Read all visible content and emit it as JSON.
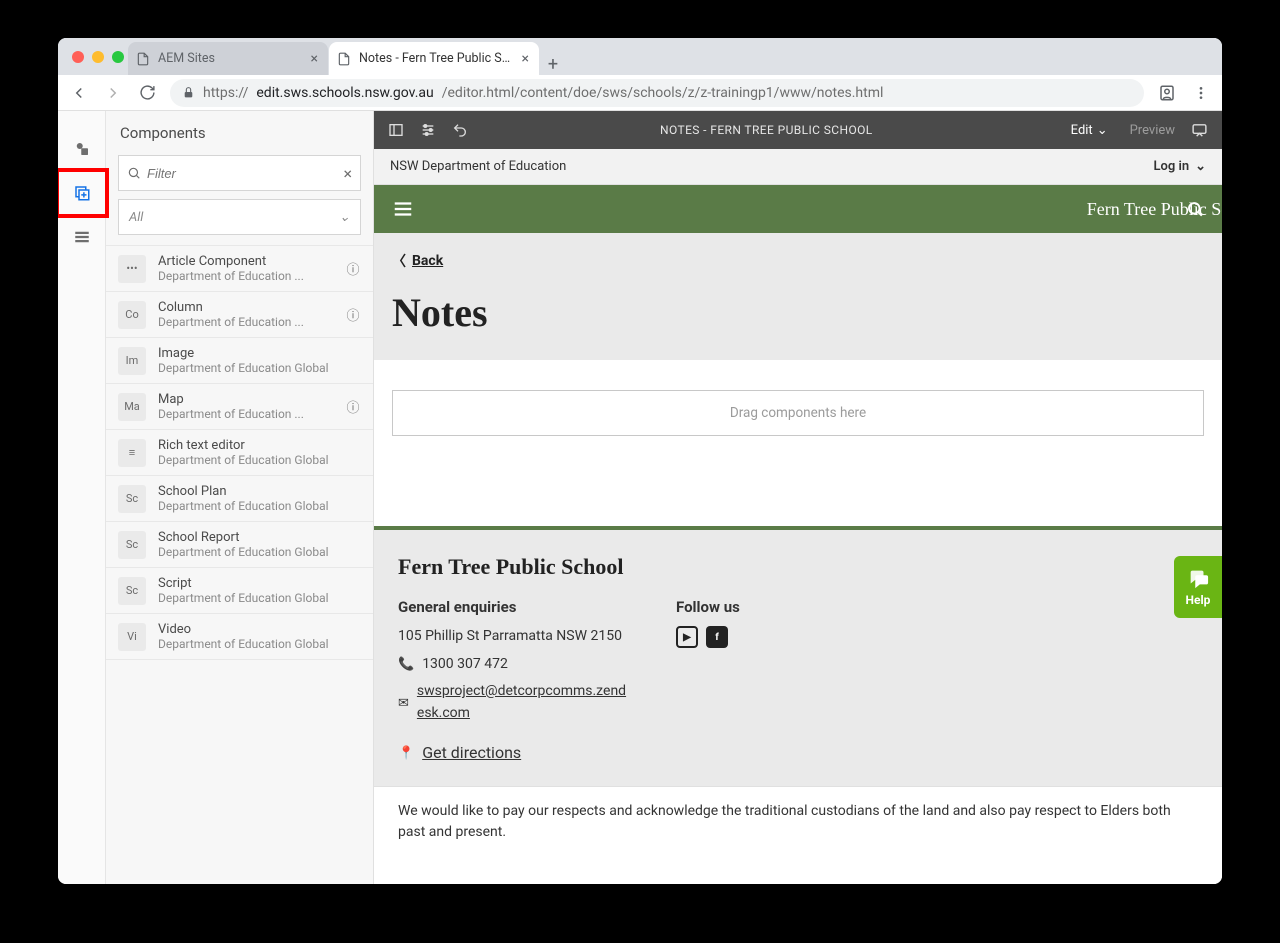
{
  "browser": {
    "tabs": [
      {
        "title": "AEM Sites",
        "active": false
      },
      {
        "title": "Notes - Fern Tree Public Schoo",
        "active": true
      }
    ],
    "url_host": "edit.sws.schools.nsw.gov.au",
    "url_path": "/editor.html/content/doe/sws/schools/z/z-trainingp1/www/notes.html"
  },
  "panel": {
    "title": "Components",
    "filter_placeholder": "Filter",
    "dropdown": "All",
    "items": [
      {
        "abbr": "•••",
        "name": "Article Component",
        "group": "Department of Education ...",
        "info": true
      },
      {
        "abbr": "Co",
        "name": "Column",
        "group": "Department of Education ...",
        "info": true
      },
      {
        "abbr": "Im",
        "name": "Image",
        "group": "Department of Education Global",
        "info": false
      },
      {
        "abbr": "Ma",
        "name": "Map",
        "group": "Department of Education ...",
        "info": true
      },
      {
        "abbr": "≡",
        "name": "Rich text editor",
        "group": "Department of Education Global",
        "info": false
      },
      {
        "abbr": "Sc",
        "name": "School Plan",
        "group": "Department of Education Global",
        "info": false
      },
      {
        "abbr": "Sc",
        "name": "School Report",
        "group": "Department of Education Global",
        "info": false
      },
      {
        "abbr": "Sc",
        "name": "Script",
        "group": "Department of Education Global",
        "info": false
      },
      {
        "abbr": "Vi",
        "name": "Video",
        "group": "Department of Education Global",
        "info": false
      }
    ]
  },
  "topbar": {
    "title": "NOTES - FERN TREE PUBLIC SCHOOL",
    "mode": "Edit",
    "preview": "Preview"
  },
  "govbar": {
    "label": "NSW Department of Education",
    "login": "Log in"
  },
  "greenbar": {
    "title": "Fern Tree Public School"
  },
  "page": {
    "back": "Back",
    "heading": "Notes",
    "drop": "Drag components here"
  },
  "footer": {
    "school": "Fern Tree Public School",
    "general_h": "General enquiries",
    "address": "105 Phillip St Parramatta NSW 2150",
    "phone": "1300 307 472",
    "email": "swsproject@detcorpcomms.zendesk.com",
    "directions": "Get directions",
    "follow_h": "Follow us",
    "ack": "We would like to pay our respects and acknowledge the traditional custodians of the land and also pay respect to Elders both past and present."
  },
  "help": {
    "label": "Help"
  }
}
